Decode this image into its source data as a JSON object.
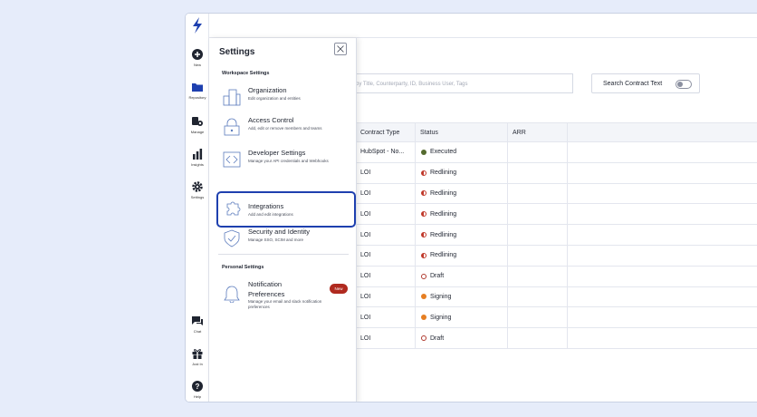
{
  "rail": {
    "items": [
      {
        "label": "New",
        "icon": "plus-circle-icon"
      },
      {
        "label": "Repository",
        "icon": "folder-icon"
      },
      {
        "label": "Manage",
        "icon": "manage-icon"
      },
      {
        "label": "Insights",
        "icon": "bar-chart-icon"
      },
      {
        "label": "Settings",
        "icon": "gear-icon"
      },
      {
        "label": "Chat",
        "icon": "chat-icon"
      },
      {
        "label": "Just In",
        "icon": "gift-icon"
      },
      {
        "label": "Help",
        "icon": "help-icon"
      }
    ]
  },
  "settings": {
    "title": "Settings",
    "workspace_label": "Workspace Settings",
    "personal_label": "Personal Settings",
    "items": [
      {
        "title": "Organization",
        "desc": "Edit organization and entities",
        "icon": "organization-icon"
      },
      {
        "title": "Access Control",
        "desc": "Add, edit or remove members and teams",
        "icon": "lock-icon"
      },
      {
        "title": "Developer Settings",
        "desc": "Manage your API credentials and Webhooks",
        "icon": "code-icon"
      },
      {
        "title": "Integrations",
        "desc": "Add and edit integrations",
        "icon": "puzzle-icon"
      },
      {
        "title": "Security and Identity",
        "desc": "Manage SSO, SCIM and more",
        "icon": "shield-icon"
      }
    ],
    "personal_items": [
      {
        "title": "Notification",
        "title2": "Preferences",
        "desc": "Manage your email and slack notification preferences",
        "badge": "New",
        "icon": "bell-icon"
      }
    ]
  },
  "search": {
    "placeholder": "rch by Title, Counterparty, ID, Business User, Tags",
    "contract_text_label": "Search Contract Text"
  },
  "table": {
    "columns": [
      "Contract Type",
      "Status",
      "ARR"
    ],
    "rows": [
      {
        "type": "HubSpot - No...",
        "status": "Executed",
        "status_color": "#556b2f",
        "status_kind": "filled"
      },
      {
        "type": "LOI",
        "status": "Redlining",
        "status_color": "#c0392b",
        "status_kind": "half"
      },
      {
        "type": "LOI",
        "status": "Redlining",
        "status_color": "#c0392b",
        "status_kind": "half"
      },
      {
        "type": "LOI",
        "status": "Redlining",
        "status_color": "#c0392b",
        "status_kind": "half"
      },
      {
        "type": "LOI",
        "status": "Redlining",
        "status_color": "#c0392b",
        "status_kind": "half"
      },
      {
        "type": "LOI",
        "status": "Redlining",
        "status_color": "#c0392b",
        "status_kind": "half"
      },
      {
        "type": "LOI",
        "status": "Draft",
        "status_color": "#b03a2e",
        "status_kind": "ring"
      },
      {
        "type": "LOI",
        "status": "Signing",
        "status_color": "#e67e22",
        "status_kind": "filled"
      },
      {
        "type": "LOI",
        "status": "Signing",
        "status_color": "#e67e22",
        "status_kind": "filled"
      },
      {
        "type": "LOI",
        "status": "Draft",
        "status_color": "#b03a2e",
        "status_kind": "ring"
      }
    ]
  },
  "colors": {
    "brand": "#1e40af",
    "badge": "#b02a1f"
  }
}
